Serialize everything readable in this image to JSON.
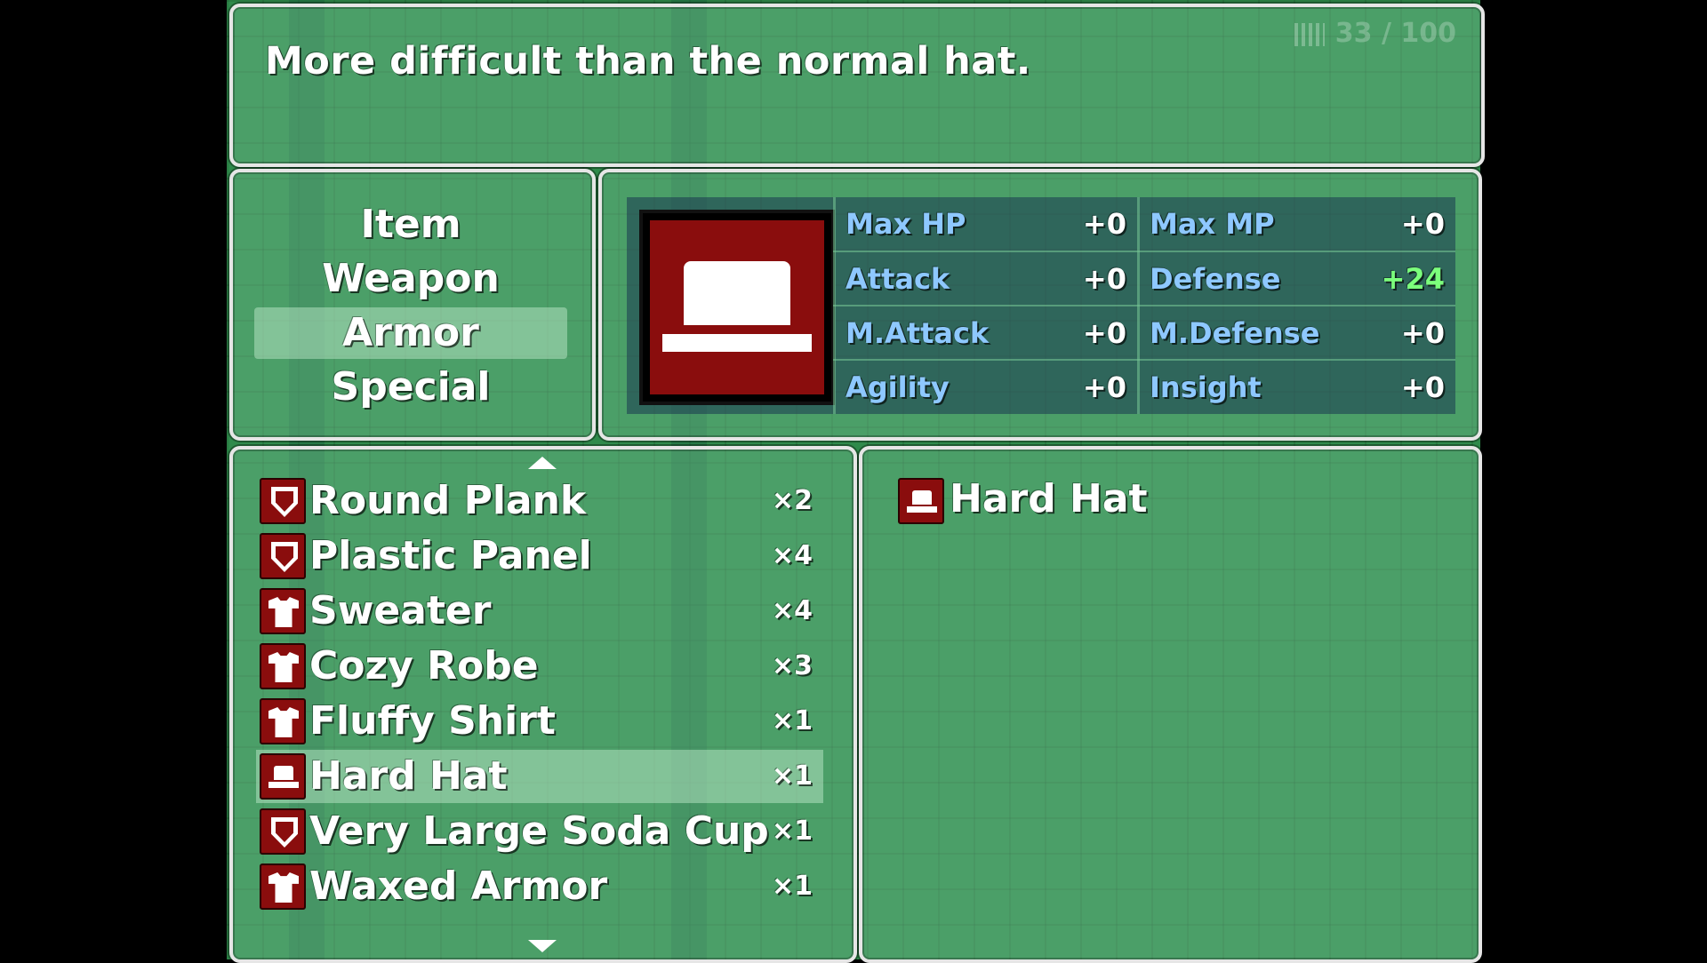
{
  "help": {
    "text": "More difficult than the normal hat.",
    "steps": "33 / 100"
  },
  "categories": [
    "Item",
    "Weapon",
    "Armor",
    "Special"
  ],
  "selected_category": "Armor",
  "status": {
    "icon": "hard-hat-icon",
    "stats": [
      {
        "label": "Max HP",
        "value": "+0"
      },
      {
        "label": "Max MP",
        "value": "+0"
      },
      {
        "label": "Attack",
        "value": "+0"
      },
      {
        "label": "Defense",
        "value": "+24",
        "color": "#7cff7c"
      },
      {
        "label": "M.Attack",
        "value": "+0"
      },
      {
        "label": "M.Defense",
        "value": "+0"
      },
      {
        "label": "Agility",
        "value": "+0"
      },
      {
        "label": "Insight",
        "value": "+0"
      }
    ]
  },
  "inventory": {
    "items": [
      {
        "name": "Round Plank",
        "qty": "×2",
        "icon": "shield-icon"
      },
      {
        "name": "Plastic Panel",
        "qty": "×4",
        "icon": "shield-icon"
      },
      {
        "name": "Sweater",
        "qty": "×4",
        "icon": "shirt-icon"
      },
      {
        "name": "Cozy Robe",
        "qty": "×3",
        "icon": "shirt-icon"
      },
      {
        "name": "Fluffy Shirt",
        "qty": "×1",
        "icon": "shirt-icon"
      },
      {
        "name": "Hard Hat",
        "qty": "×1",
        "icon": "hat-icon",
        "selected": true
      },
      {
        "name": "Very Large Soda Cup",
        "qty": "×1",
        "icon": "shield-icon"
      },
      {
        "name": "Waxed Armor",
        "qty": "×1",
        "icon": "shirt-icon"
      }
    ]
  },
  "detail": {
    "name": "Hard Hat",
    "icon": "hat-icon"
  },
  "colors": {
    "icon_bg": "#8a0d0d",
    "stat_label": "#8ec8ff",
    "stat_up": "#7cff7c",
    "selection": "#c8f0d2"
  }
}
